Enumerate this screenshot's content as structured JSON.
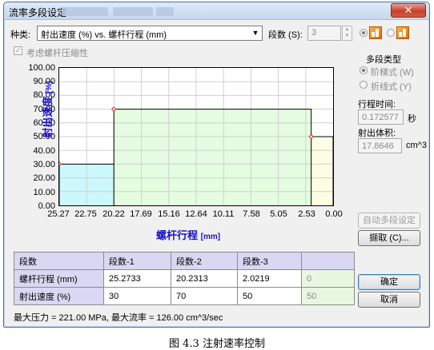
{
  "window": {
    "title": "流率多段设定",
    "close": "✕"
  },
  "toolbar": {
    "type_label": "种类:",
    "type_value": "射出速度 (%) vs. 螺杆行程 (mm)",
    "segments_label": "段数 (S):",
    "segments_value": "3",
    "compression_label": "考虑螺杆压缩性"
  },
  "segment_type": {
    "title": "多段类型",
    "options": [
      "阶梯式 (W)",
      "折线式 (Y)"
    ],
    "selected": 0
  },
  "stroke_time": {
    "label": "行程时间:",
    "value": "0.172577",
    "unit": "秒"
  },
  "shot_volume": {
    "label": "射出体积:",
    "value": "17.8646",
    "unit": "cm^3"
  },
  "buttons": {
    "auto": "自动多段设定",
    "fetch": "撷取 (C)...",
    "ok": "确定",
    "cancel": "取消"
  },
  "chart_data": {
    "type": "area",
    "step": true,
    "ylabel_main": "射出速度",
    "ylabel_unit": "[%]",
    "xlabel_main": "螺杆行程",
    "xlabel_unit": "[mm]",
    "ylim": [
      0,
      100
    ],
    "xlim": [
      25.27,
      0.0
    ],
    "y_ticks": [
      "100.00",
      "90.00",
      "80.00",
      "70.00",
      "60.00",
      "50.00",
      "40.00",
      "30.00",
      "20.00",
      "10.00",
      "0.00"
    ],
    "x_ticks": [
      "25.27",
      "22.75",
      "20.22",
      "17.69",
      "15.16",
      "12.64",
      "10.11",
      "7.58",
      "5.05",
      "2.53",
      "0.00"
    ],
    "segments": [
      {
        "start": 25.2733,
        "end": 20.2313,
        "value": 30,
        "color": "#ccf8fc"
      },
      {
        "start": 20.2313,
        "end": 2.0219,
        "value": 70,
        "color": "#e4fce0"
      },
      {
        "start": 2.0219,
        "end": 0.0,
        "value": 50,
        "color": "#fdfde4"
      }
    ],
    "line_color": "#000000",
    "marker_color": "#e02020"
  },
  "table": {
    "headers": [
      "段数",
      "段数-1",
      "段数-2",
      "段数-3",
      ""
    ],
    "rows": [
      {
        "label": "螺杆行程 (mm)",
        "values": [
          "25.2733",
          "20.2313",
          "2.0219",
          "0"
        ]
      },
      {
        "label": "射出速度 (%)",
        "values": [
          "30",
          "70",
          "50",
          "50"
        ]
      }
    ]
  },
  "status": "最大压力 = 221.00 MPa, 最大流率 = 126.00 cm^3/sec",
  "caption": "图 4.3 注射速率控制"
}
